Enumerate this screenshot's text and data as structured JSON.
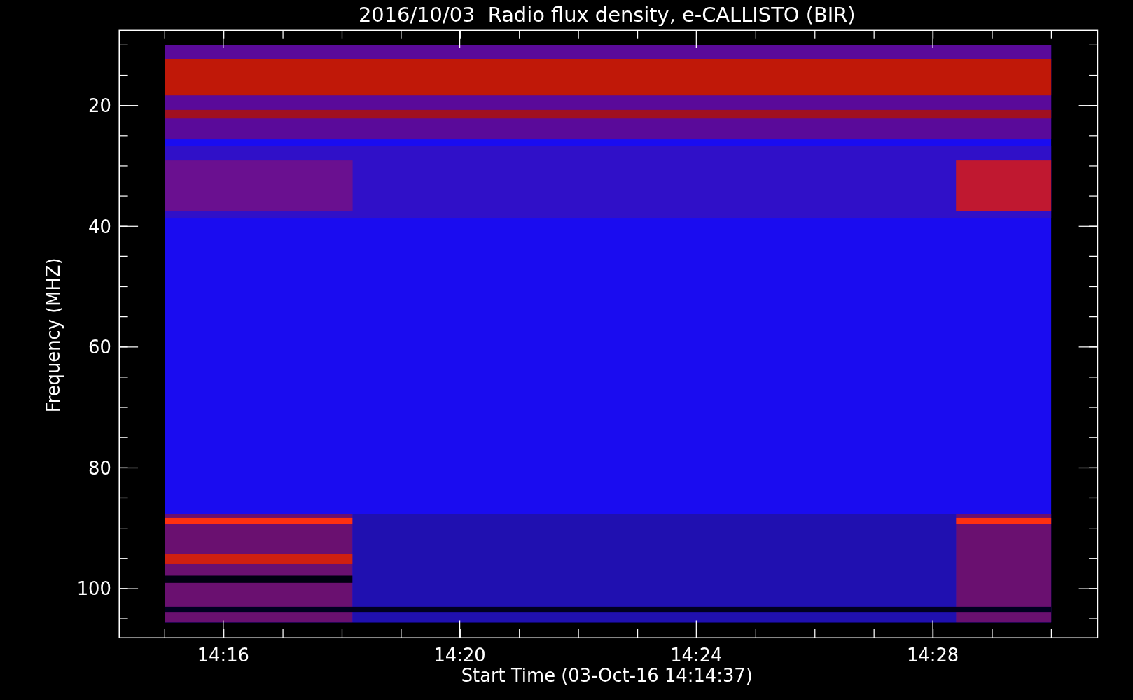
{
  "title": "2016/10/03  Radio flux density, e-CALLISTO (BIR)",
  "xlabel": "Start Time (03-Oct-16 14:14:37)",
  "ylabel": "Frequency (MHZ)",
  "xticks": [
    "14:16",
    "14:20",
    "14:24",
    "14:28"
  ],
  "yticks": [
    "20",
    "40",
    "60",
    "80",
    "100"
  ]
}
